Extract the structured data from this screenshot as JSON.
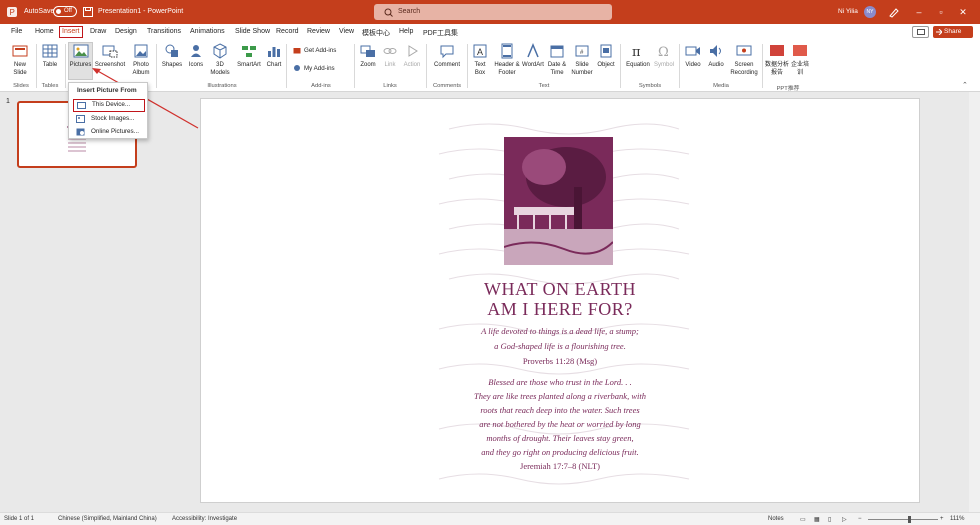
{
  "titlebar": {
    "autosave_label": "AutoSave",
    "autosave_state": "Off",
    "doc_title": "Presentation1 - PowerPoint",
    "search_placeholder": "Search",
    "user_name": "Ni Yilia",
    "user_initials": "NY"
  },
  "tabs": [
    "File",
    "Home",
    "Insert",
    "Draw",
    "Design",
    "Transitions",
    "Animations",
    "Slide Show",
    "Record",
    "Review",
    "View",
    "模板中心",
    "Help",
    "PDF工具集"
  ],
  "active_tab": "Insert",
  "share_label": "Share",
  "ribbon": {
    "slides": {
      "new_slide": "New Slide",
      "group": "Slides"
    },
    "tables": {
      "table": "Table",
      "group": "Tables"
    },
    "images": {
      "pictures": "Pictures",
      "screenshot": "Screenshot",
      "photo_album": "Photo Album"
    },
    "illustrations": {
      "shapes": "Shapes",
      "icons": "Icons",
      "models": "3D Models",
      "smartart": "SmartArt",
      "chart": "Chart",
      "group": "Illustrations"
    },
    "addins": {
      "get": "Get Add-ins",
      "my": "My Add-ins",
      "group": "Add-ins"
    },
    "links": {
      "zoom": "Zoom",
      "link": "Link",
      "action": "Action",
      "group": "Links"
    },
    "comments": {
      "comment": "Comment",
      "group": "Comments"
    },
    "text": {
      "textbox": "Text Box",
      "header": "Header & Footer",
      "wordart": "WordArt",
      "datetime": "Date & Time",
      "slidenum": "Slide Number",
      "object": "Object",
      "group": "Text"
    },
    "symbols": {
      "equation": "Equation",
      "symbol": "Symbol",
      "group": "Symbols"
    },
    "media": {
      "video": "Video",
      "audio": "Audio",
      "screen": "Screen Recording",
      "group": "Media"
    },
    "ppt": {
      "a": "数据分析报告",
      "b": "企业培训",
      "group": "PPT推荐"
    }
  },
  "dropdown": {
    "header": "Insert Picture From",
    "items": [
      "This Device...",
      "Stock Images...",
      "Online Pictures..."
    ]
  },
  "slide": {
    "number": "1",
    "title1": "WHAT ON EARTH",
    "title2": "AM I HERE FOR?",
    "lines": [
      "A life devoted to things is a dead life, a stump;",
      "a God-shaped life is a flourishing tree.",
      "Proverbs 11:28 (Msg)",
      "Blessed are those who trust in the Lord. . .",
      "They are like trees planted along a riverbank, with",
      "roots that reach deep into the water. Such trees",
      "are not bothered by the heat or worried by long",
      "months of drought. Their leaves stay green,",
      "and they go right on producing delicious fruit.",
      "Jeremiah 17:7–8 (NLT)"
    ]
  },
  "status": {
    "slide_of": "Slide 1 of 1",
    "language": "Chinese (Simplified, Mainland China)",
    "accessibility": "Accessibility: Investigate",
    "notes": "Notes",
    "zoom": "111%"
  },
  "colors": {
    "brand": "#c43e1c",
    "highlight": "#c0151a",
    "art": "#7a2a5a"
  }
}
